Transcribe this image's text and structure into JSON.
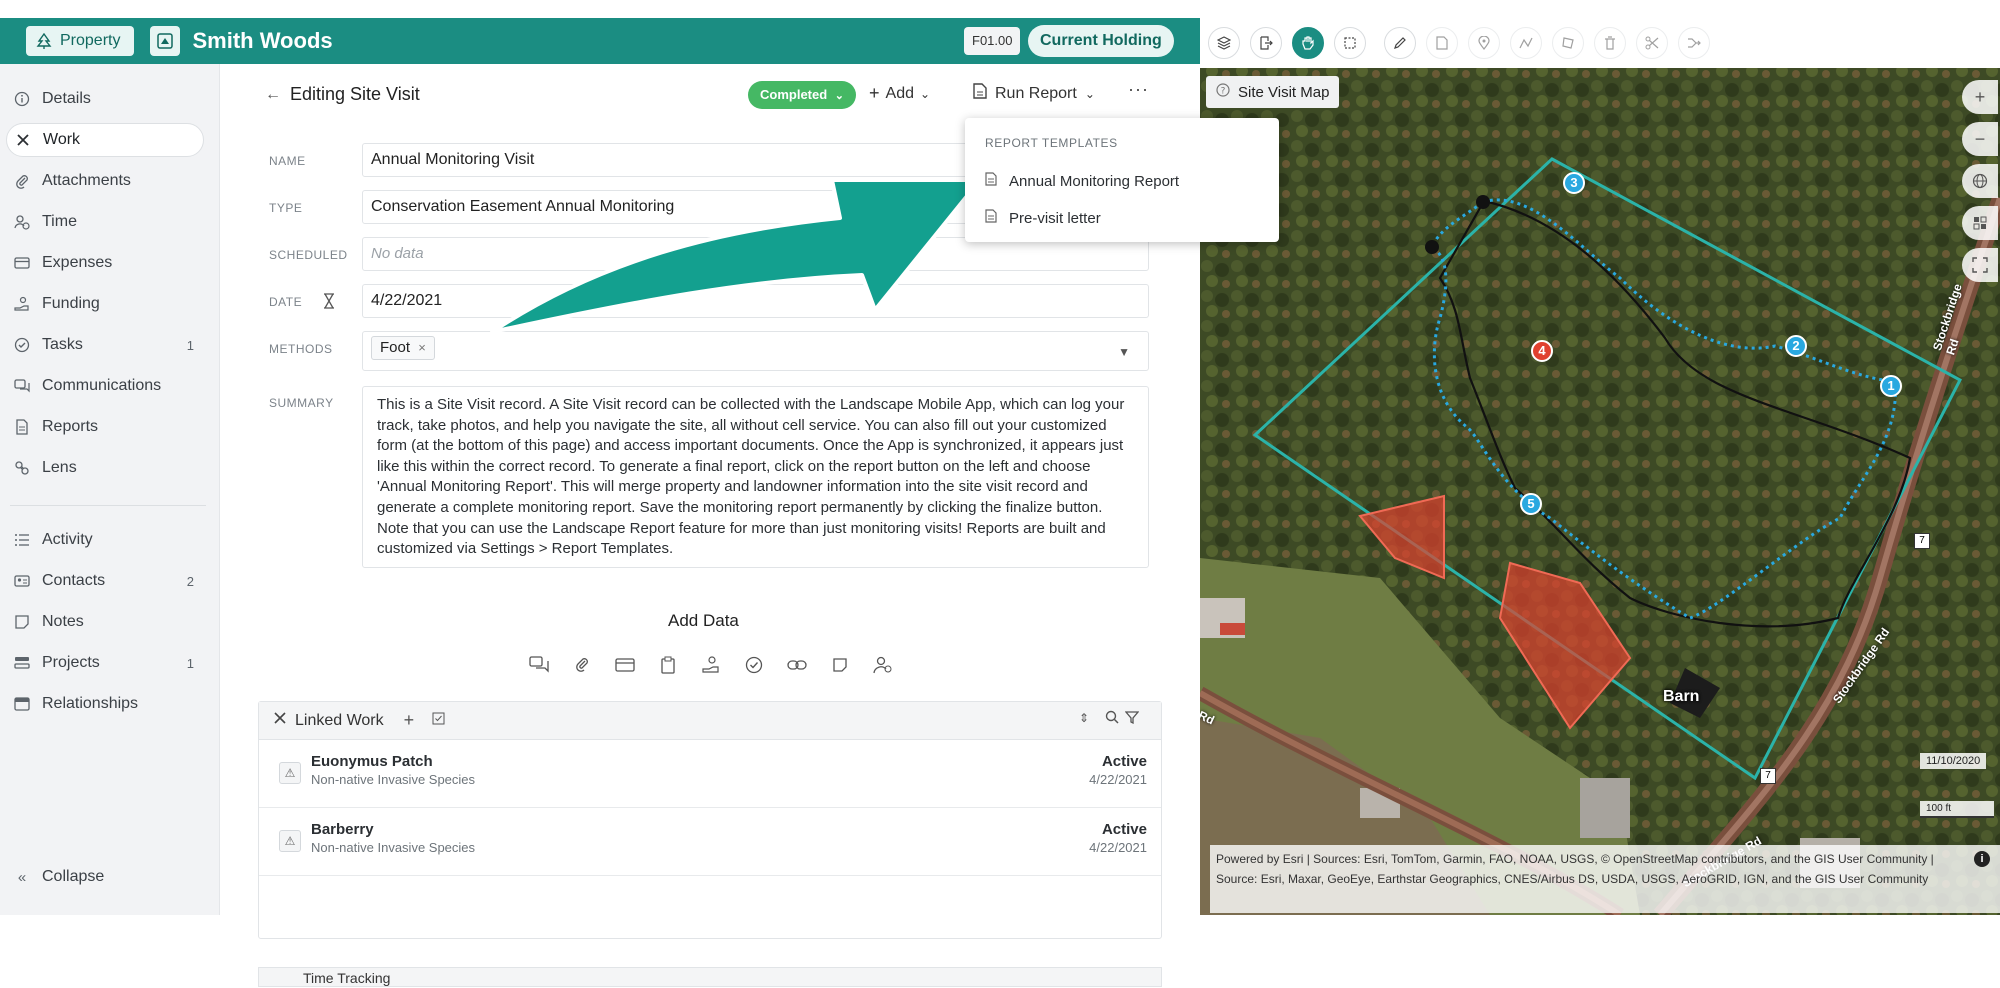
{
  "header": {
    "property_badge": "Property",
    "property_name": "Smith Woods",
    "code": "F01.00",
    "holding_status": "Current Holding"
  },
  "sidebar": {
    "items": [
      {
        "label": "Details",
        "icon": "info-icon"
      },
      {
        "label": "Work",
        "icon": "tools-icon",
        "active": true
      },
      {
        "label": "Attachments",
        "icon": "paperclip-icon"
      },
      {
        "label": "Time",
        "icon": "clock-user-icon"
      },
      {
        "label": "Expenses",
        "icon": "card-icon"
      },
      {
        "label": "Funding",
        "icon": "hand-coin-icon"
      },
      {
        "label": "Tasks",
        "icon": "check-circle-icon",
        "count": "1"
      },
      {
        "label": "Communications",
        "icon": "chat-icon"
      },
      {
        "label": "Reports",
        "icon": "document-icon"
      },
      {
        "label": "Lens",
        "icon": "lens-icon"
      }
    ],
    "items2": [
      {
        "label": "Activity",
        "icon": "list-icon"
      },
      {
        "label": "Contacts",
        "icon": "contact-card-icon",
        "count": "2"
      },
      {
        "label": "Notes",
        "icon": "note-icon"
      },
      {
        "label": "Projects",
        "icon": "project-icon",
        "count": "1"
      },
      {
        "label": "Relationships",
        "icon": "relationships-icon"
      }
    ],
    "collapse": "Collapse"
  },
  "main": {
    "title": "Editing Site Visit",
    "status": "Completed",
    "add_label": "Add",
    "run_report_label": "Run Report",
    "more": "···",
    "fields": {
      "name_label": "NAME",
      "name_value": "Annual Monitoring Visit",
      "type_label": "TYPE",
      "type_value": "Conservation Easement Annual Monitoring",
      "scheduled_label": "SCHEDULED",
      "scheduled_placeholder": "No data",
      "date_label": "DATE",
      "date_value": "4/22/2021",
      "methods_label": "METHODS",
      "methods_chip": "Foot",
      "summary_label": "SUMMARY",
      "summary_value": "This is a Site Visit record.  A Site Visit record can be collected with the Landscape Mobile App, which can log your track, take photos, and help you navigate the site, all without cell service.  You can also fill out your customized form (at the bottom of this page) and access important documents.  Once the App is synchronized, it appears just like this within the correct record. To generate a final report, click on the report button on the left and choose 'Annual Monitoring Report'. This will merge property and landowner information into the site visit record and generate a complete monitoring report.  Save the monitoring report permanently by clicking the finalize button. Note that you can use the Landscape Report feature for more than just monitoring visits! Reports are built and customized via Settings > Report Templates."
    },
    "add_data_title": "Add Data",
    "linked_work": {
      "title": "Linked Work",
      "rows": [
        {
          "name": "Euonymus Patch",
          "sub": "Non-native Invasive Species",
          "status": "Active",
          "date": "4/22/2021"
        },
        {
          "name": "Barberry",
          "sub": "Non-native Invasive Species",
          "status": "Active",
          "date": "4/22/2021"
        }
      ]
    },
    "time_tracking": "Time Tracking"
  },
  "dropdown": {
    "heading": "REPORT TEMPLATES",
    "items": [
      "Annual Monitoring Report",
      "Pre-visit letter"
    ]
  },
  "map": {
    "label": "Site Visit Map",
    "waypoints": [
      "1",
      "2",
      "3",
      "4",
      "5"
    ],
    "barn_label": "Barn",
    "road_label_1": "Stockbridge Rd",
    "road_label_2": "Stockbridge Rd",
    "road_label_3": "Stockbridge Rd",
    "road_label_4": "Rd",
    "route_shield": "7",
    "date_stamp": "11/10/2020",
    "scale": "100 ft",
    "attribution": "Powered by Esri | Sources: Esri, TomTom, Garmin, FAO, NOAA, USGS, © OpenStreetMap contributors, and the GIS User Community | Source: Esri, Maxar, GeoEye, Earthstar Geographics, CNES/Airbus DS, USDA, USGS, AeroGRID, IGN, and the GIS User Community"
  },
  "colors": {
    "brand": "#1b8d82",
    "status_green": "#45b864",
    "boundary": "#2bb3a9",
    "track_blue": "#29a8e0",
    "invasive_red": "#e0412f"
  }
}
